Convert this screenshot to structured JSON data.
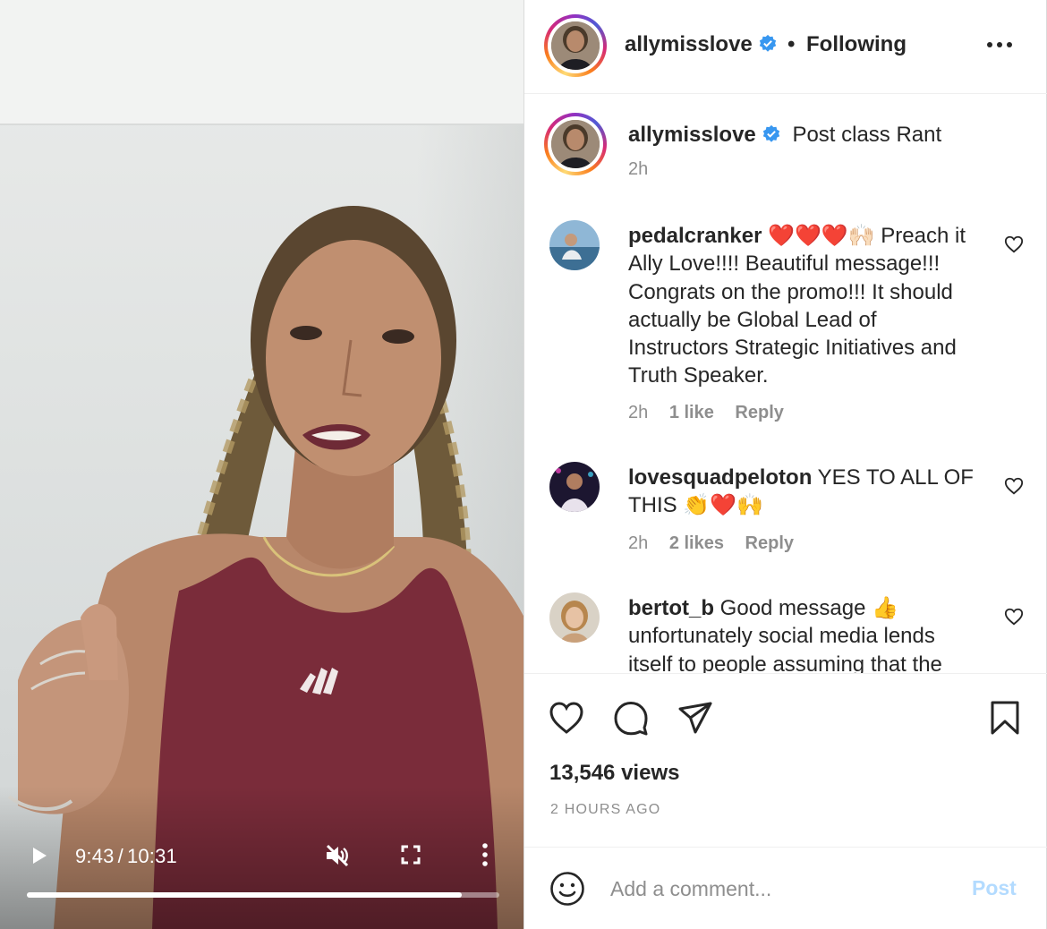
{
  "video": {
    "time_current": "9:43",
    "time_separator": "/",
    "time_total": "10:31",
    "progress_fraction": 0.92,
    "shirt_logo": "adidas",
    "play_icon": "play-icon",
    "mute_icon": "muted-speaker-icon",
    "fullscreen_icon": "fullscreen-icon",
    "more_icon": "vertical-ellipsis-icon"
  },
  "header": {
    "username": "allymisslove",
    "separator": "•",
    "follow_label": "Following",
    "more_icon": "horizontal-ellipsis-icon"
  },
  "caption": {
    "username": "allymisslove",
    "text": "Post class Rant",
    "time": "2h"
  },
  "comments": [
    {
      "username": "pedalcranker",
      "text": "❤️❤️❤️🙌🏻 Preach it Ally Love!!!! Beautiful message!!! Congrats on the promo!!! It should actually be Global Lead of Instructors Strategic Initiatives and Truth Speaker.",
      "time": "2h",
      "likes": "1 like",
      "reply": "Reply"
    },
    {
      "username": "lovesquadpeloton",
      "text": "YES TO ALL OF THIS 👏❤️🙌",
      "time": "2h",
      "likes": "2 likes",
      "reply": "Reply"
    },
    {
      "username": "bertot_b",
      "text": "Good message 👍 unfortunately social media lends itself to people assuming that the",
      "time": "",
      "likes": "",
      "reply": ""
    }
  ],
  "actions": {
    "like_icon": "heart-icon",
    "comment_icon": "speech-bubble-icon",
    "share_icon": "paper-plane-icon",
    "save_icon": "bookmark-icon",
    "views": "13,546 views",
    "posted": "2 HOURS AGO"
  },
  "composer": {
    "emoji_icon": "smiley-icon",
    "placeholder": "Add a comment...",
    "post_label": "Post"
  },
  "colors": {
    "verified": "#3897f0",
    "muted_text": "#8e8e8e",
    "post_disabled": "#b3dbff",
    "heart_red": "#ed4956"
  }
}
